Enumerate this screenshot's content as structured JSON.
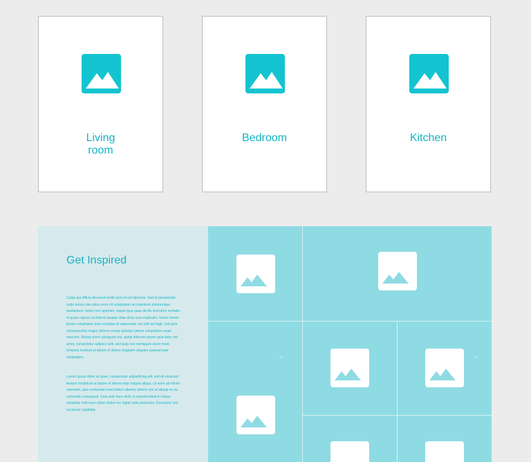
{
  "categories": [
    {
      "label": "Living\nroom",
      "icon": "image-icon"
    },
    {
      "label": "Bedroom",
      "icon": "image-icon"
    },
    {
      "label": "Kitchen",
      "icon": "image-icon"
    }
  ],
  "inspired": {
    "title": "Get Inspired",
    "paragraph1": "Culpa qui officia deserunt mollit anim id est laborum. Sed ut perspiciatis unde omnis iste natus error sit voluptatem accusantium doloremque laudantium, totam rem aperiam, eaque ipsa quae ab illo inventore veritatis et quasi ropeior architecto beatae vitae dicta sunt explicabo. Nemo mnem ipsam voluptatem quia voluptas sit aspernatur aut odit aut fugit, sed quia consequuntur magni dolores eosep quiotop ratione voluptatem sequi nesciunt. Neque porro quisquam est, quepi dolorem ipsum quia dolor srit amet, consectetur adipisci velit, sed quia non numquam eiaris modi tempora incidunt ut labore et dolore magnam aliquam quaerat iope voluptatem.",
    "paragraph2": "Lorem ipsum dolor sit amet, consectetur adipisificing elit, sed do eiusmod tempor incididunt ut labore et dolore mqo magna aliqua. Ut enim ad minim veeniami, quis nostrudad exercitation ullamco laboris nisi ut aliquip ex ea commodo consequat. Duis aute irure dolor in reprehenderit in tufpoy voluptate velit esse cillum dolore eu fugiat nulla pariaratur. Excepteur sint occaecat cupidatat."
  },
  "icons": {
    "image": "image-icon",
    "prev": "arrow-left-icon",
    "next": "arrow-right-icon"
  },
  "colors": {
    "accent": "#13c4d0",
    "grid_bg": "#8fdbe3",
    "panel_bg": "#d6eaed",
    "page_bg": "#ececec"
  }
}
